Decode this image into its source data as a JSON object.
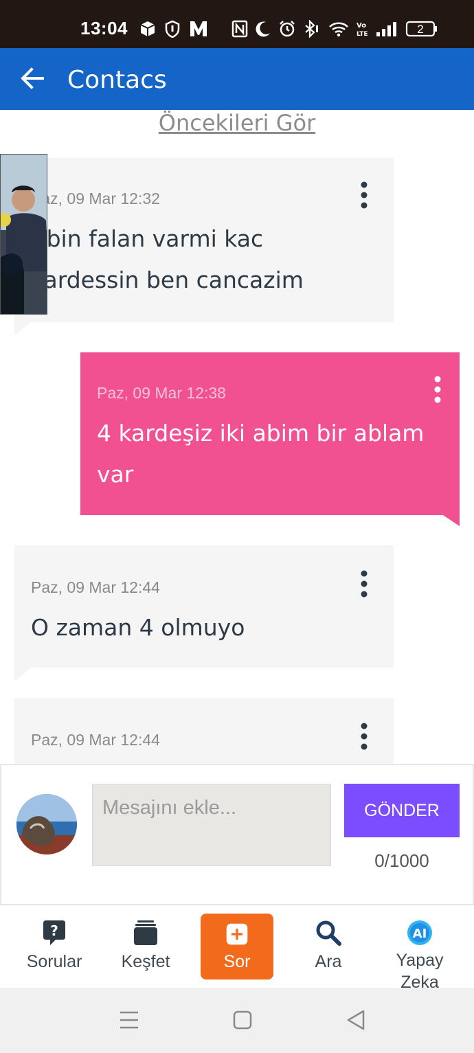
{
  "status_bar": {
    "time": "13:04",
    "battery": "2",
    "icons": [
      "cube-icon",
      "shield-icon",
      "m-icon",
      "nfc-icon",
      "moon-icon",
      "alarm-icon",
      "bluetooth-icon",
      "wifi-icon",
      "volte-icon",
      "signal-icon",
      "battery-icon"
    ]
  },
  "app_bar": {
    "title": "Contacs",
    "back_icon": "arrow-left-icon"
  },
  "chat": {
    "see_previous": "Öncekileri Gör",
    "messages": [
      {
        "direction": "incoming",
        "timestamp": "Paz, 09 Mar 12:32",
        "text": "Abin falan varmi kac kardessin ben cancazim"
      },
      {
        "direction": "outgoing",
        "timestamp": "Paz, 09 Mar 12:38",
        "text": "4 kardeşiz iki abim bir ablam var"
      },
      {
        "direction": "incoming",
        "timestamp": "Paz, 09 Mar 12:44",
        "text": "O zaman 4 olmuyo"
      },
      {
        "direction": "incoming",
        "timestamp": "Paz, 09 Mar 12:44",
        "text": ""
      }
    ]
  },
  "composer": {
    "placeholder": "Mesajını ekle...",
    "value": "",
    "send_label": "GÖNDER",
    "counter": "0/1000"
  },
  "bottom_nav": {
    "items": [
      {
        "label": "Sorular",
        "icon": "question-bubble-icon"
      },
      {
        "label": "Keşfet",
        "icon": "cards-stack-icon"
      },
      {
        "label": "Sor",
        "icon": "plus-square-icon"
      },
      {
        "label": "Ara",
        "icon": "search-icon"
      },
      {
        "label": "Yapay Zeka",
        "icon": "ai-icon"
      }
    ]
  },
  "colors": {
    "app_bar": "#1565c8",
    "outgoing_bubble": "#f25191",
    "incoming_bubble": "#f5f5f5",
    "send_button": "#7c4dff",
    "ask_button": "#f26a1b"
  }
}
